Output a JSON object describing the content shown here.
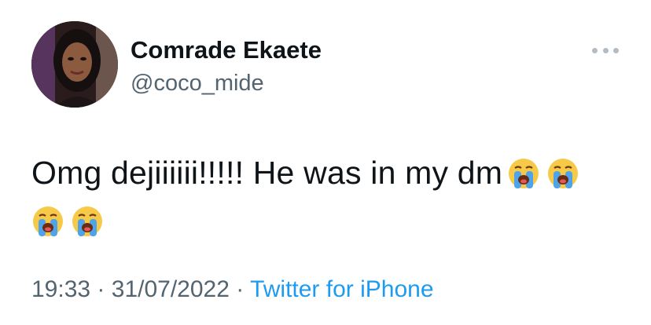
{
  "author": {
    "display_name": "Comrade Ekaete",
    "handle": "@coco_mide",
    "avatar_icon": "profile-photo"
  },
  "more_icon": "ellipsis-icon",
  "tweet": {
    "text": "Omg dejiiiiii!!!!! He was in my dm",
    "emojis": [
      "loudly-crying-face",
      "loudly-crying-face",
      "loudly-crying-face",
      "loudly-crying-face"
    ]
  },
  "meta": {
    "time": "19:33",
    "date": "31/07/2022",
    "separator": "·",
    "source": "Twitter for iPhone"
  },
  "colors": {
    "text": "#0f1419",
    "secondary": "#536471",
    "link": "#1d9bf0"
  }
}
